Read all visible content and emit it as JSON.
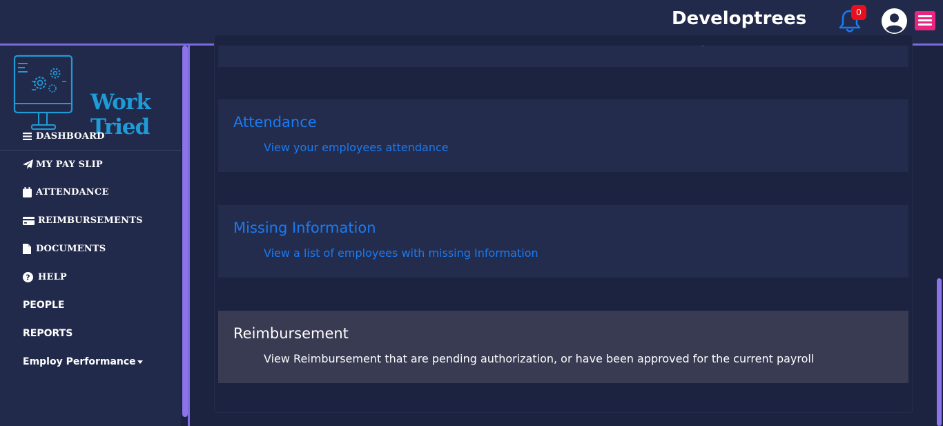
{
  "header": {
    "brand": "Developtrees",
    "notification_count": "0",
    "colors": {
      "bar": "#222a4b",
      "accent_line": "#7b6ae0",
      "bell": "#1a7bf2",
      "badge": "#e8101e",
      "menu": "#e8267f"
    },
    "icons": {
      "bell": "bell-icon",
      "avatar": "user-circle-icon",
      "menu": "hamburger-icon"
    }
  },
  "sidebar": {
    "logo_text": "Work Tried",
    "items": [
      {
        "label": "DASHBOARD",
        "icon": "bars-icon"
      },
      {
        "label": "MY PAY SLIP",
        "icon": "paper-plane-icon"
      },
      {
        "label": "ATTENDANCE",
        "icon": "calendar-icon"
      },
      {
        "label": "REIMBURSEMENTS",
        "icon": "credit-card-icon"
      },
      {
        "label": "DOCUMENTS",
        "icon": "file-icon"
      },
      {
        "label": "HELP",
        "icon": "question-circle-icon"
      },
      {
        "label": "PEOPLE"
      },
      {
        "label": "REPORTS"
      },
      {
        "label": "Employ Performance",
        "icon": "caret-down-icon"
      }
    ]
  },
  "main": {
    "cards": [
      {
        "title": "Attendance",
        "description": "View your employees attendance"
      },
      {
        "title": "Missing Information",
        "description": "View a list of employees with missing Information"
      },
      {
        "title": "Reimbursement",
        "description": "View Reimbursement that are pending authorization, or have been approved for the current payroll"
      }
    ],
    "colors": {
      "card": "#242c4e",
      "card_active": "#383b52",
      "link": "#1a7bf2"
    }
  }
}
